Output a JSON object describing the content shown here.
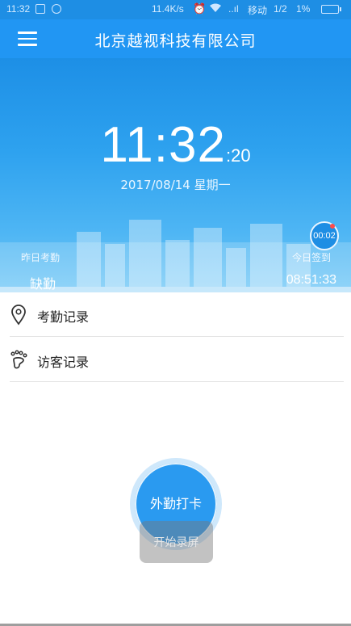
{
  "status_bar": {
    "time": "11:32",
    "speed": "11.4K/s",
    "carrier": "移动",
    "sim": "1/2",
    "battery_text": "1%",
    "signal": "..ıl"
  },
  "app_bar": {
    "title": "北京越视科技有限公司",
    "menu_icon": "hamburger-menu-icon"
  },
  "hero": {
    "time_main": "11:32",
    "time_seconds": ":20",
    "date": "2017/08/14 星期一",
    "record_badge": "00:02",
    "yesterday_label": "昨日考勤",
    "yesterday_value": "缺勤",
    "today_label": "今日签到",
    "today_value": "08:51:33"
  },
  "menu": [
    {
      "label": "考勤记录",
      "icon": "location-pin-icon"
    },
    {
      "label": "访客记录",
      "icon": "footprint-icon"
    }
  ],
  "clock_in": {
    "label": "外勤打卡",
    "toast": "开始录屏"
  },
  "colors": {
    "primary": "#2196f3",
    "status_bar": "#1e8ee4",
    "button": "#2a9af0"
  }
}
